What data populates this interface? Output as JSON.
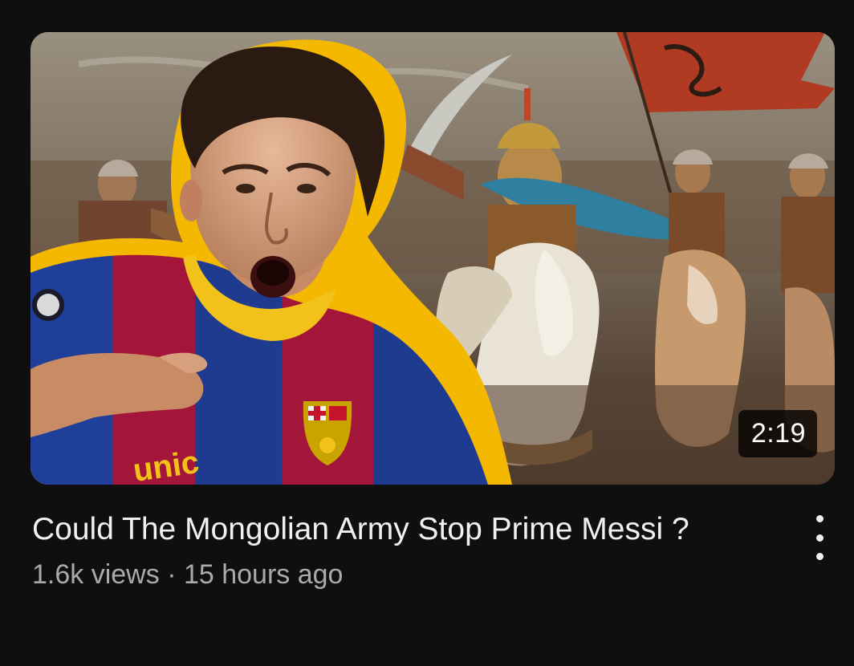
{
  "video": {
    "duration": "2:19",
    "title": "Could The Mongolian Army Stop Prime Messi ?",
    "views": "1.6k views",
    "separator": "·",
    "age": "15 hours ago"
  },
  "thumbnail": {
    "shirt_text": "unic"
  },
  "colors": {
    "background": "#0f0f0f",
    "title": "#f1f1f1",
    "meta": "#aaaaaa",
    "outline": "#f5b800"
  },
  "icons": {
    "menu": "more-vertical-icon"
  }
}
